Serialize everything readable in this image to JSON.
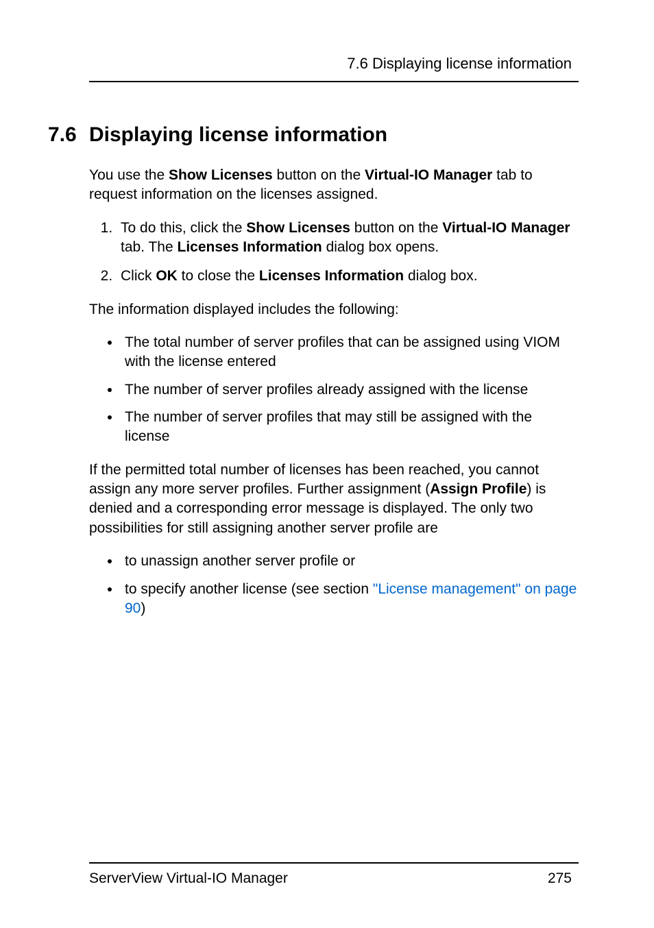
{
  "header": {
    "running_head": "7.6 Displaying license information"
  },
  "section": {
    "number": "7.6",
    "title": "Displaying license information"
  },
  "intro": {
    "parts": [
      "You use the ",
      "Show Licenses",
      " button on the ",
      "Virtual-IO Manager",
      " tab to request information on the licenses assigned."
    ]
  },
  "steps": [
    {
      "parts": [
        "To do this, click the ",
        "Show Licenses",
        " button on the ",
        "Virtual-IO Manager",
        " tab. The ",
        "Licenses Information",
        " dialog box opens."
      ]
    },
    {
      "parts": [
        "Click ",
        "OK",
        " to close the ",
        "Licenses Information",
        " dialog box."
      ]
    }
  ],
  "para_info_intro": "The information displayed includes the following:",
  "info_bullets": [
    "The total number of server profiles that can be assigned using VIOM with the license entered",
    "The number of server profiles already assigned with the license",
    "The number of server profiles that may still be assigned with the license"
  ],
  "para_limit": {
    "parts": [
      "If the permitted total number of licenses has been reached, you cannot assign any more server profiles. Further assignment (",
      "Assign Profile",
      ") is denied and a corresponding error message is displayed. The only two possibilities for still assigning another server profile are"
    ]
  },
  "option_bullets": [
    {
      "plain": "to unassign another server profile or"
    },
    {
      "prefix": "to specify another license (see section ",
      "link": "\"License management\" on page 90",
      "suffix": ")"
    }
  ],
  "footer": {
    "doc_title": "ServerView Virtual-IO Manager",
    "page_number": "275"
  }
}
